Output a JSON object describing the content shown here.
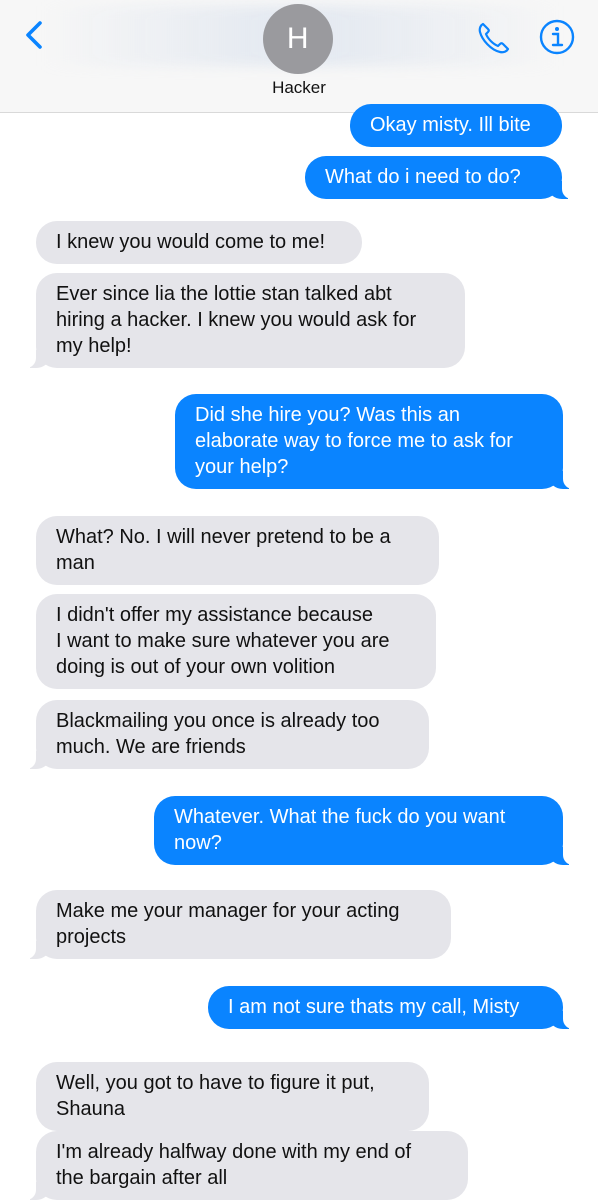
{
  "contact": {
    "initial": "H",
    "name": "Hacker"
  },
  "colors": {
    "accent": "#0a84ff",
    "incoming": "#e5e5ea",
    "outgoing": "#0a84ff"
  },
  "icons": {
    "back": "chevron-left-icon",
    "call": "phone-icon",
    "info": "info-icon"
  },
  "messages": [
    {
      "from": "me",
      "text": "Okay misty. Ill bite"
    },
    {
      "from": "me",
      "text": "What do i need to do?"
    },
    {
      "from": "them",
      "text": "I knew you would come to me!"
    },
    {
      "from": "them",
      "text": "Ever since lia the lottie stan talked abt\nhiring a hacker. I knew you would ask for\nmy help!"
    },
    {
      "from": "me",
      "text": "Did she hire you? Was this an\nelaborate way to force me to ask for\nyour help?"
    },
    {
      "from": "them",
      "text": "What? No. I will never pretend to be a\nman"
    },
    {
      "from": "them",
      "text": "I didn't offer my assistance because\nI want to make sure whatever you are\ndoing is out of your own volition"
    },
    {
      "from": "them",
      "text": "Blackmailing you once is already too\nmuch. We are friends"
    },
    {
      "from": "me",
      "text": "Whatever. What the fuck do you want\nnow?"
    },
    {
      "from": "them",
      "text": "Make me your manager for your acting\nprojects"
    },
    {
      "from": "me",
      "text": "I am not sure thats my call, Misty"
    },
    {
      "from": "them",
      "text": "Well, you got to have to figure it put,\nShauna"
    },
    {
      "from": "them",
      "text": "I'm already halfway done with my end of\nthe bargain after all"
    }
  ]
}
